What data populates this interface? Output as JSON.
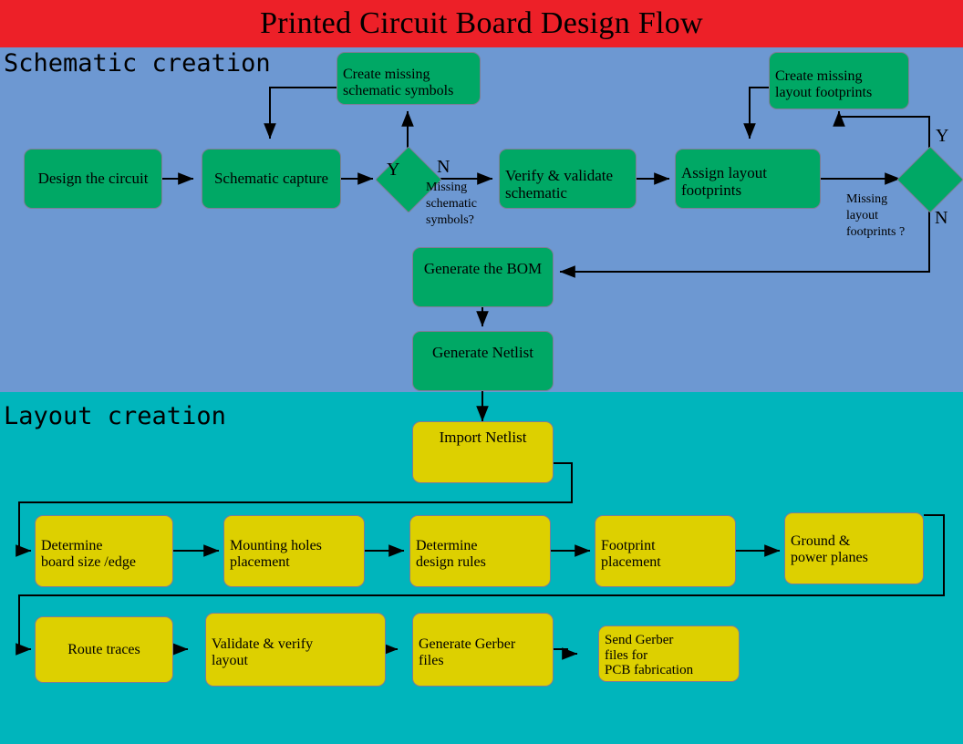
{
  "title": "Printed Circuit Board Design Flow",
  "colors": {
    "header_red": "#ed2028",
    "schematic_blue": "#6d98d2",
    "layout_teal": "#00b5bc",
    "process_green": "#00a865",
    "process_yellow": "#ddd000",
    "line_black": "#000000"
  },
  "sections": {
    "schematic": {
      "label": "Schematic creation"
    },
    "layout": {
      "label": "Layout creation"
    }
  },
  "schematic_nodes": {
    "design_circuit": "Design the circuit",
    "schematic_capture": "Schematic capture",
    "create_missing_symbols_l1": "Create missing",
    "create_missing_symbols_l2": "schematic symbols",
    "verify_validate_l1": "Verify & validate",
    "verify_validate_l2": "schematic",
    "assign_footprints_l1": "Assign layout",
    "assign_footprints_l2": "footprints",
    "create_missing_footprints_l1": "Create missing",
    "create_missing_footprints_l2": "layout footprints",
    "generate_bom": "Generate the BOM",
    "generate_netlist": "Generate Netlist"
  },
  "decisions": {
    "missing_symbols": {
      "question_l1": "Missing",
      "question_l2": "schematic",
      "question_l3": "symbols?",
      "yes_label": "Y",
      "no_label": "N"
    },
    "missing_footprints": {
      "question_l1": "Missing",
      "question_l2": "layout",
      "question_l3": "footprints ?",
      "yes_label": "Y",
      "no_label": "N"
    }
  },
  "layout_nodes": {
    "import_netlist": "Import Netlist",
    "board_size_l1": "Determine",
    "board_size_l2": "board size /edge",
    "mounting_holes_l1": "Mounting holes",
    "mounting_holes_l2": "placement",
    "design_rules_l1": "Determine",
    "design_rules_l2": "design rules",
    "footprint_placement_l1": "Footprint",
    "footprint_placement_l2": "placement",
    "ground_power_l1": "Ground &",
    "ground_power_l2": "power planes",
    "route_traces": "Route traces",
    "validate_layout_l1": "Validate & verify",
    "validate_layout_l2": "layout",
    "generate_gerber_l1": "Generate Gerber",
    "generate_gerber_l2": "files",
    "send_gerber_l1": "Send Gerber",
    "send_gerber_l2": "files for",
    "send_gerber_l3": "PCB fabrication"
  }
}
